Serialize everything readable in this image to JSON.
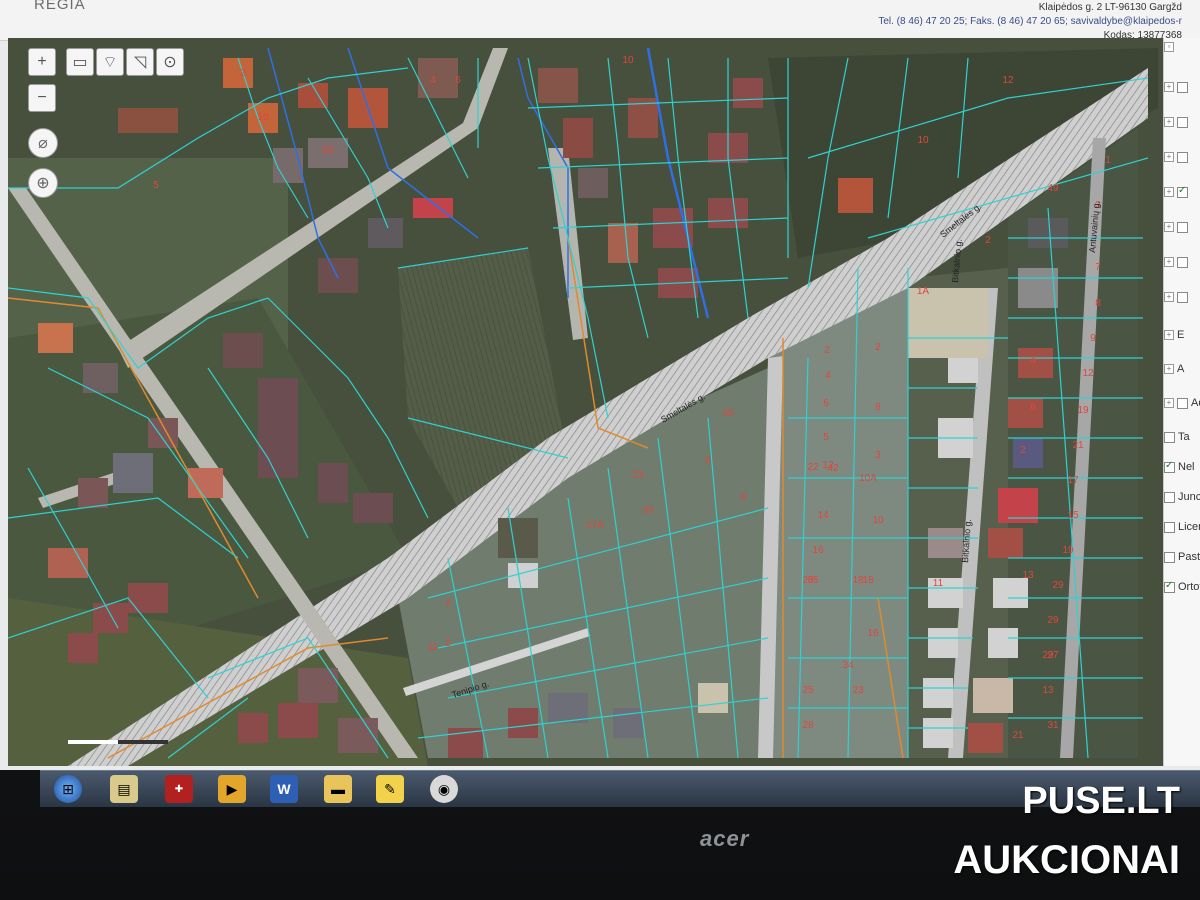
{
  "header": {
    "site_name": "REGIA",
    "contact_line1": "Klaipėdos g. 2 LT-96130 Gargžd",
    "contact_line2": "Tel. (8 46) 47 20 25; Faks. (8 46) 47 20 65; savivaldybe@klaipedos-r",
    "contact_line3": "Kodas: 13877368"
  },
  "map": {
    "streets": [
      "Smeltalės g.",
      "Smeltalės g.",
      "Tenipio g.",
      "Bitkalnio g.",
      "Antuvainių g.",
      "Bitkalnio g."
    ],
    "parcel_numbers": [
      "10",
      "6",
      "2",
      "4",
      "2A",
      "10",
      "12",
      "10",
      "5",
      "49",
      "2",
      "3",
      "7",
      "8",
      "9",
      "12",
      "19",
      "21",
      "17",
      "15",
      "1",
      "4",
      "6",
      "2",
      "1A",
      "2",
      "2",
      "4",
      "8",
      "6",
      "11",
      "18",
      "3",
      "12",
      "10",
      "16",
      "22",
      "14",
      "27A",
      "23",
      "35",
      "31",
      "13",
      "11",
      "33",
      "4",
      "19",
      "29",
      "29",
      "27",
      "9",
      "5",
      "2",
      "45",
      "42",
      "10A",
      "16",
      "18",
      "20",
      "23",
      "8",
      "34",
      "25",
      "13",
      "29",
      "28",
      "21"
    ],
    "colors": {
      "parcel_line": "#2fd1d1",
      "label": "#e0463d",
      "road": "#bfbfbf",
      "utility_blue": "#2f6fe6",
      "utility_orange": "#e08a2e"
    }
  },
  "toolbar": {
    "icons": [
      "zoom-in-icon",
      "zoom-out-icon",
      "measure-ruler-icon",
      "pin-icon",
      "export-icon",
      "target-icon",
      "north-compass-icon",
      "locate-icon"
    ]
  },
  "layers": [
    {
      "label": "E",
      "checked": false
    },
    {
      "label": "A",
      "checked": false
    },
    {
      "label": "Ad",
      "checked": false
    },
    {
      "label": "Ta",
      "checked": false
    },
    {
      "label": "Nel",
      "checked": true
    },
    {
      "label": "Junc",
      "checked": false
    },
    {
      "label": "Licen",
      "checked": false
    },
    {
      "label": "Pasta",
      "checked": false
    },
    {
      "label": "Ortofo",
      "checked": true
    }
  ],
  "taskbar": {
    "icons": [
      "windows-start-icon",
      "file-explorer-icon",
      "app-64-icon",
      "media-player-icon",
      "word-icon",
      "folder-icon",
      "notes-icon",
      "chrome-icon"
    ]
  },
  "monitor": {
    "brand": "acer"
  },
  "watermark": {
    "line1": "PUSE.LT",
    "line2": "AUKCIONAI"
  }
}
